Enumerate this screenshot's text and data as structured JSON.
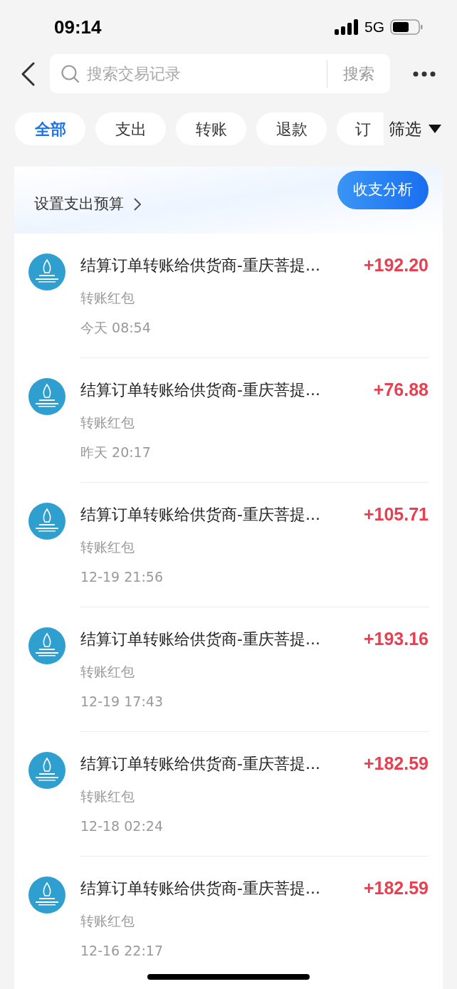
{
  "status_bar": {
    "time": "09:14",
    "network": "5G"
  },
  "search": {
    "placeholder": "搜索交易记录",
    "button": "搜索"
  },
  "tabs": [
    {
      "label": "全部",
      "selected": true
    },
    {
      "label": "支出",
      "selected": false
    },
    {
      "label": "转账",
      "selected": false
    },
    {
      "label": "退款",
      "selected": false
    },
    {
      "label": "订",
      "selected": false
    }
  ],
  "filter": {
    "label": "筛选"
  },
  "budget": {
    "label": "设置支出预算",
    "analysis_button": "收支分析"
  },
  "transactions": [
    {
      "title": "结算订单转账给供货商-重庆菩提...",
      "category": "转账红包",
      "time": "今天 08:54",
      "amount": "+192.20"
    },
    {
      "title": "结算订单转账给供货商-重庆菩提...",
      "category": "转账红包",
      "time": "昨天 20:17",
      "amount": "+76.88"
    },
    {
      "title": "结算订单转账给供货商-重庆菩提...",
      "category": "转账红包",
      "time": "12-19 21:56",
      "amount": "+105.71"
    },
    {
      "title": "结算订单转账给供货商-重庆菩提...",
      "category": "转账红包",
      "time": "12-19 17:43",
      "amount": "+193.16"
    },
    {
      "title": "结算订单转账给供货商-重庆菩提...",
      "category": "转账红包",
      "time": "12-18 02:24",
      "amount": "+182.59"
    },
    {
      "title": "结算订单转账给供货商-重庆菩提...",
      "category": "转账红包",
      "time": "12-16 22:17",
      "amount": "+182.59"
    }
  ]
}
